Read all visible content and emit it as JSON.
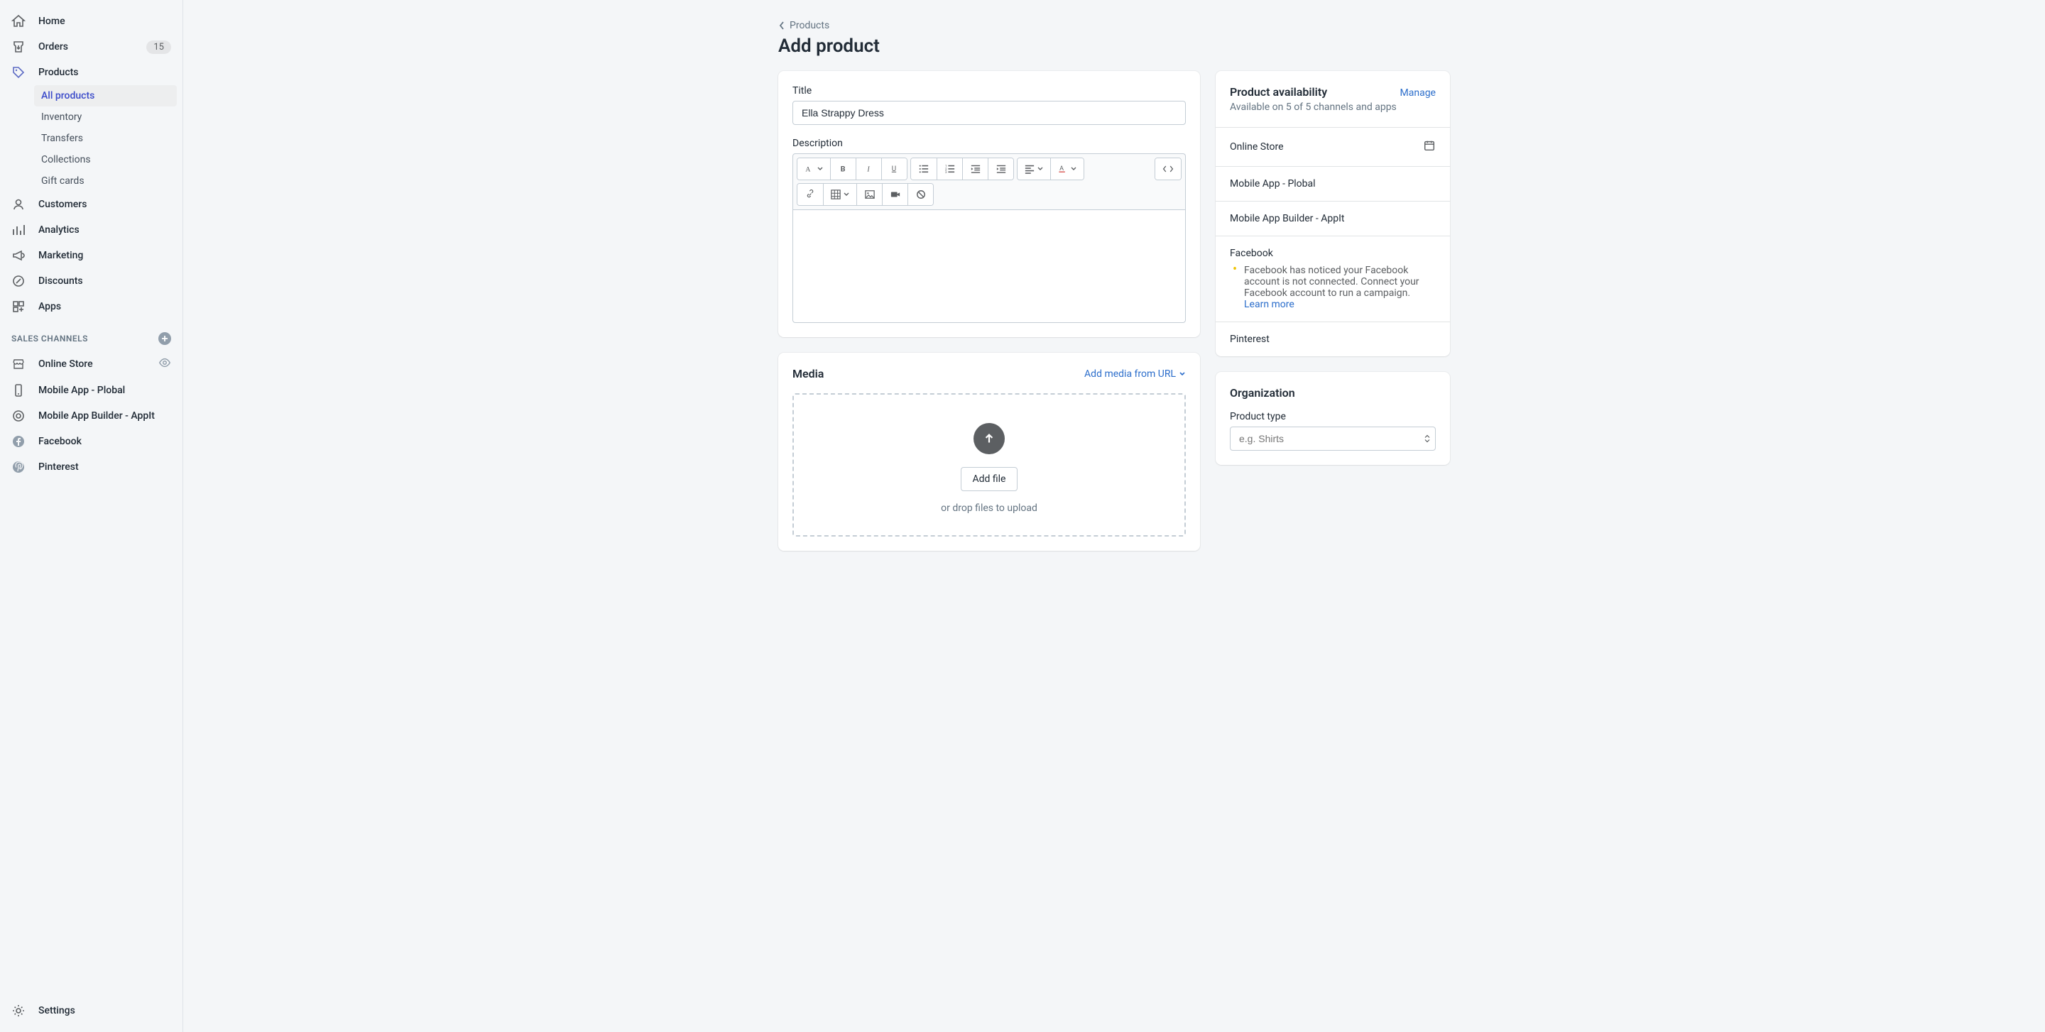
{
  "sidebar": {
    "nav": [
      {
        "label": "Home"
      },
      {
        "label": "Orders",
        "badge": "15"
      },
      {
        "label": "Products",
        "active": true
      },
      {
        "label": "Customers"
      },
      {
        "label": "Analytics"
      },
      {
        "label": "Marketing"
      },
      {
        "label": "Discounts"
      },
      {
        "label": "Apps"
      }
    ],
    "products_sub": [
      {
        "label": "All products",
        "selected": true
      },
      {
        "label": "Inventory"
      },
      {
        "label": "Transfers"
      },
      {
        "label": "Collections"
      },
      {
        "label": "Gift cards"
      }
    ],
    "channels_header": "SALES CHANNELS",
    "channels": [
      {
        "label": "Online Store"
      },
      {
        "label": "Mobile App - Plobal"
      },
      {
        "label": "Mobile App Builder - AppIt"
      },
      {
        "label": "Facebook"
      },
      {
        "label": "Pinterest"
      }
    ],
    "settings_label": "Settings"
  },
  "breadcrumb": {
    "label": "Products"
  },
  "page_title": "Add product",
  "title_field": {
    "label": "Title",
    "value": "Ella Strappy Dress"
  },
  "description_field": {
    "label": "Description"
  },
  "media": {
    "heading": "Media",
    "add_url": "Add media from URL",
    "add_file_btn": "Add file",
    "hint": "or drop files to upload"
  },
  "availability": {
    "heading": "Product availability",
    "manage": "Manage",
    "subtext": "Available on 5 of 5 channels and apps",
    "channels": [
      {
        "label": "Online Store",
        "calendar": true
      },
      {
        "label": "Mobile App - Plobal"
      },
      {
        "label": "Mobile App Builder - AppIt"
      },
      {
        "label": "Facebook",
        "warn": "Facebook has noticed your Facebook account is not connected. Connect your Facebook account to run a campaign. ",
        "learn": "Learn more"
      },
      {
        "label": "Pinterest"
      }
    ]
  },
  "organization": {
    "heading": "Organization",
    "product_type_label": "Product type",
    "product_type_placeholder": "e.g. Shirts"
  }
}
